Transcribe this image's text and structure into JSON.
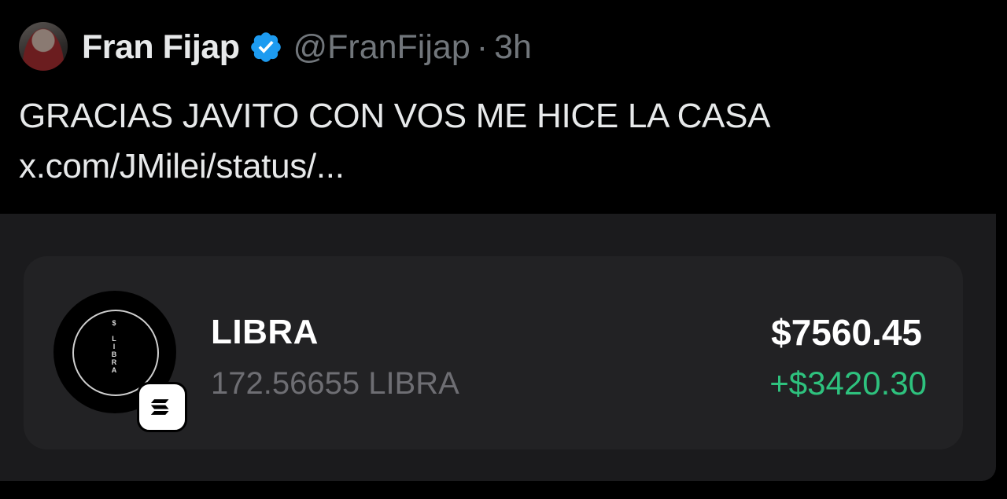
{
  "tweet": {
    "display_name": "Fran Fijap",
    "handle": "@FranFijap",
    "separator": "·",
    "timestamp": "3h",
    "text": "GRACIAS JAVITO CON VOS ME HICE LA CASA",
    "link": "x.com/JMilei/status/...",
    "avatar_icon": "profile-photo",
    "verified_icon": "verified-badge-icon",
    "verified_color": "#1d9bf0"
  },
  "wallet": {
    "token_name": "LIBRA",
    "token_amount": "172.56655 LIBRA",
    "token_value": "$7560.45",
    "token_change": "+$3420.30",
    "token_logo_text": "$ LIBRA",
    "chain_icon": "solana-icon",
    "change_color": "#2ec27e"
  }
}
